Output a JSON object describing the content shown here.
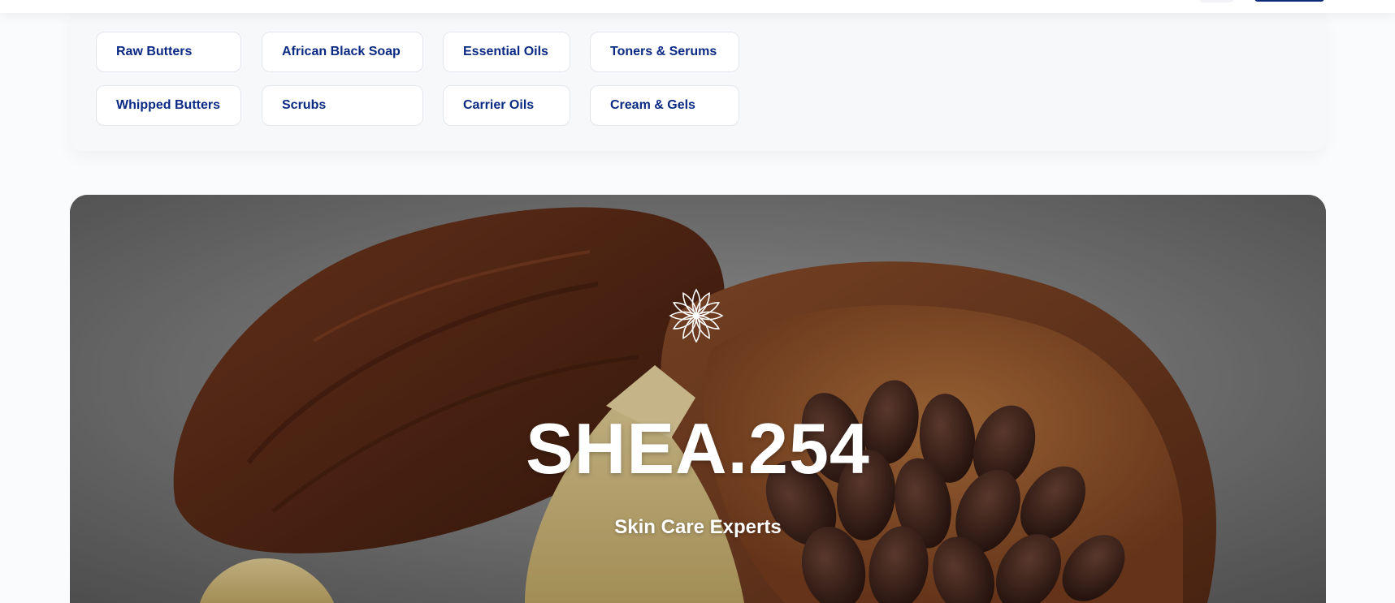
{
  "categories": {
    "row1": [
      "Raw Butters",
      "African Black Soap",
      "Essential Oils",
      "Toners & Serums"
    ],
    "row2": [
      "Whipped Butters",
      "Scrubs",
      "Carrier Oils",
      "Cream & Gels"
    ]
  },
  "hero": {
    "logo_icon": "lotus-flower-icon",
    "title": "SHEA.254",
    "subtitle": "Skin Care Experts"
  },
  "colors": {
    "chip_text": "#0b2a83",
    "accent": "#0a2a7a",
    "hero_text": "#ffffff"
  }
}
